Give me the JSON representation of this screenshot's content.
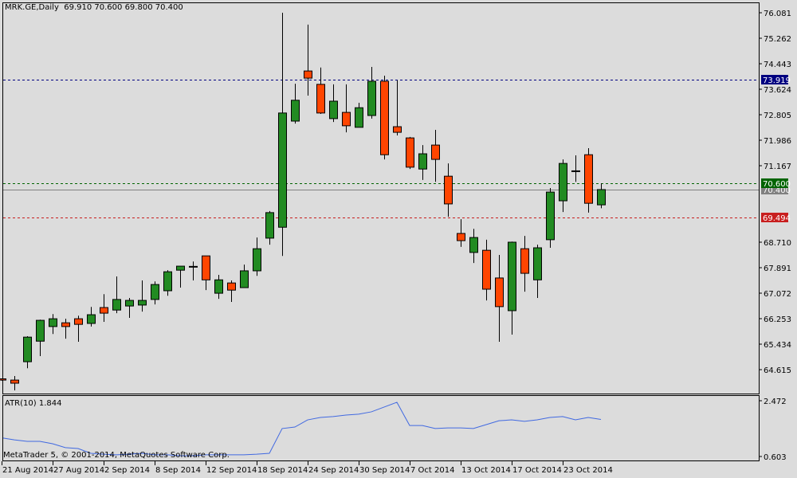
{
  "header": {
    "symbol_info": "MRK.GE,Daily",
    "ohlc": "69.910 70.600 69.800 70.400"
  },
  "colors": {
    "background": "#dcdcdc",
    "bull": "#228b22",
    "bear": "#ff4500",
    "atr_line": "#4169e1",
    "ask_line": "#000080",
    "high_line": "#006400",
    "bid_line": "#808080",
    "low_line": "#c81e1e"
  },
  "price_axis": {
    "labels": [
      "76.081",
      "75.262",
      "74.443",
      "73.624",
      "72.805",
      "71.986",
      "71.167",
      "68.710",
      "67.891",
      "67.072",
      "66.253",
      "65.434",
      "64.615"
    ],
    "max": 76.081,
    "step": 0.819
  },
  "markers": [
    {
      "label": "73.919",
      "value": 73.919,
      "color": "#000080",
      "style": "dashed"
    },
    {
      "label": "70.600",
      "value": 70.6,
      "color": "#006400",
      "style": "dashed"
    },
    {
      "label": "70.400",
      "value": 70.4,
      "color": "#808080",
      "style": "solid"
    },
    {
      "label": "69.494",
      "value": 69.494,
      "color": "#c81e1e",
      "style": "dashed"
    }
  ],
  "candles": [
    [
      64.32,
      64.33,
      64.26,
      64.28
    ],
    [
      64.28,
      64.41,
      63.95,
      64.18
    ],
    [
      64.87,
      65.69,
      64.66,
      65.66
    ],
    [
      65.53,
      66.22,
      65.05,
      66.2
    ],
    [
      66.0,
      66.4,
      65.76,
      66.25
    ],
    [
      66.12,
      66.25,
      65.61,
      66.0
    ],
    [
      66.25,
      66.35,
      65.51,
      66.07
    ],
    [
      66.1,
      66.63,
      66.0,
      66.38
    ],
    [
      66.61,
      67.04,
      66.15,
      66.43
    ],
    [
      66.53,
      67.61,
      66.43,
      66.87
    ],
    [
      66.66,
      66.92,
      66.28,
      66.84
    ],
    [
      66.69,
      67.48,
      66.48,
      66.84
    ],
    [
      66.87,
      67.45,
      66.71,
      67.35
    ],
    [
      67.15,
      67.81,
      66.99,
      67.76
    ],
    [
      67.81,
      67.94,
      67.25,
      67.94
    ],
    [
      67.91,
      68.09,
      67.48,
      67.92
    ],
    [
      68.27,
      68.27,
      67.17,
      67.5
    ],
    [
      67.07,
      67.66,
      66.89,
      67.5
    ],
    [
      67.4,
      67.48,
      66.79,
      67.17
    ],
    [
      67.25,
      67.99,
      67.25,
      67.79
    ],
    [
      67.79,
      68.86,
      67.63,
      68.5
    ],
    [
      68.84,
      69.71,
      68.63,
      69.66
    ],
    [
      69.19,
      76.08,
      68.27,
      72.86
    ],
    [
      72.6,
      73.8,
      72.52,
      73.27
    ],
    [
      74.21,
      75.7,
      73.42,
      73.98
    ],
    [
      73.78,
      74.32,
      72.83,
      72.86
    ],
    [
      72.68,
      73.78,
      72.57,
      73.24
    ],
    [
      72.88,
      73.78,
      72.24,
      72.45
    ],
    [
      72.4,
      73.19,
      72.4,
      73.03
    ],
    [
      72.78,
      74.34,
      72.68,
      73.88
    ],
    [
      73.88,
      74.06,
      71.37,
      71.52
    ],
    [
      72.42,
      73.91,
      72.14,
      72.24
    ],
    [
      72.06,
      72.09,
      71.06,
      71.12
    ],
    [
      71.06,
      71.83,
      70.71,
      71.55
    ],
    [
      71.83,
      72.32,
      70.65,
      71.37
    ],
    [
      70.83,
      71.24,
      69.53,
      69.94
    ],
    [
      68.99,
      69.45,
      68.56,
      68.76
    ],
    [
      68.38,
      69.14,
      68.04,
      68.86
    ],
    [
      68.45,
      68.79,
      66.84,
      67.2
    ],
    [
      67.56,
      68.3,
      65.51,
      66.64
    ],
    [
      66.51,
      68.73,
      65.74,
      68.71
    ],
    [
      68.5,
      68.91,
      67.12,
      67.71
    ],
    [
      67.5,
      68.63,
      66.92,
      68.53
    ],
    [
      68.79,
      70.45,
      68.53,
      70.32
    ],
    [
      70.04,
      71.37,
      69.68,
      71.24
    ],
    [
      70.99,
      71.5,
      70.65,
      70.99
    ],
    [
      71.52,
      71.73,
      69.66,
      69.96
    ],
    [
      69.91,
      70.6,
      69.8,
      70.4
    ]
  ],
  "atr": {
    "label": "ATR(10) 1.844",
    "axis_labels": [
      "2.472",
      "0.603"
    ],
    "max": 2.472,
    "min": 0.603,
    "values": [
      1.22,
      1.16,
      1.11,
      1.11,
      1.03,
      0.9,
      0.87,
      0.71,
      0.68,
      0.66,
      0.68,
      0.71,
      0.66,
      0.66,
      0.63,
      0.63,
      0.66,
      0.66,
      0.66,
      0.66,
      0.68,
      0.71,
      1.54,
      1.59,
      1.83,
      1.91,
      1.94,
      1.99,
      2.02,
      2.1,
      2.26,
      2.42,
      1.64,
      1.64,
      1.54,
      1.56,
      1.56,
      1.54,
      1.67,
      1.8,
      1.83,
      1.78,
      1.83,
      1.91,
      1.94,
      1.83,
      1.91,
      1.844
    ]
  },
  "copyright": "MetaTrader 5, © 2001-2014, MetaQuotes Software Corp.",
  "date_axis": [
    {
      "label": "21 Aug 2014",
      "index": 0
    },
    {
      "label": "27 Aug 2014",
      "index": 4
    },
    {
      "label": "2 Sep 2014",
      "index": 8
    },
    {
      "label": "8 Sep 2014",
      "index": 12
    },
    {
      "label": "12 Sep 2014",
      "index": 16
    },
    {
      "label": "18 Sep 2014",
      "index": 20
    },
    {
      "label": "24 Sep 2014",
      "index": 24
    },
    {
      "label": "30 Sep 2014",
      "index": 28
    },
    {
      "label": "7 Oct 2014",
      "index": 32
    },
    {
      "label": "13 Oct 2014",
      "index": 36
    },
    {
      "label": "17 Oct 2014",
      "index": 40
    },
    {
      "label": "23 Oct 2014",
      "index": 44
    }
  ]
}
